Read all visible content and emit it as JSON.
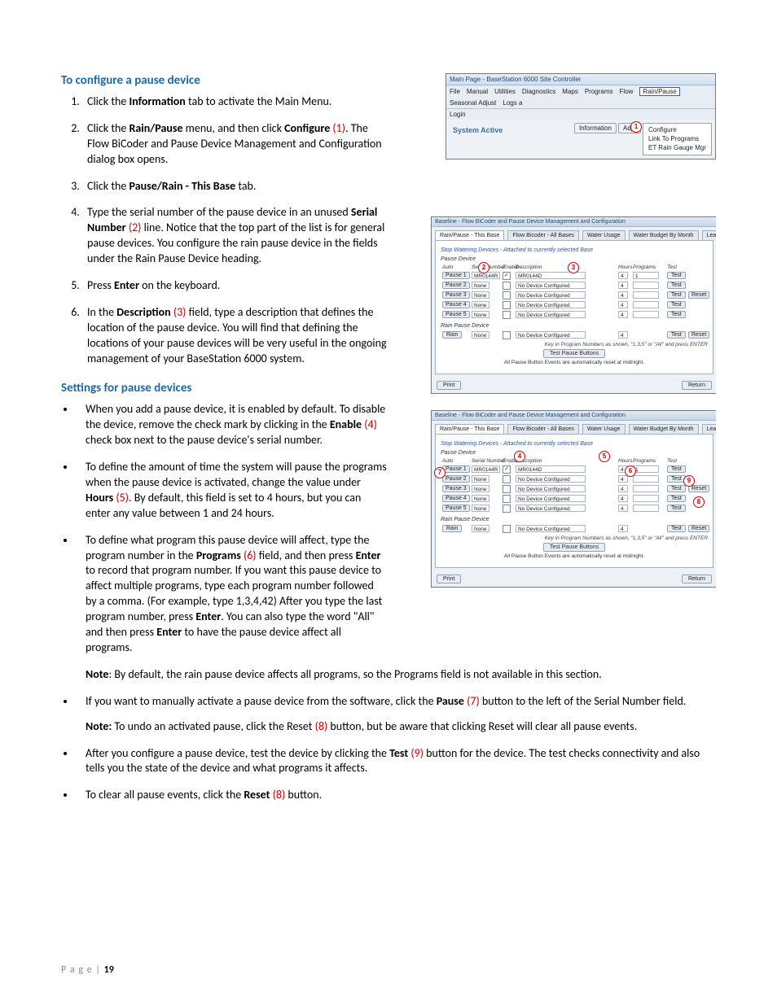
{
  "section1": {
    "heading": "To configure a pause device",
    "step1_a": "Click the ",
    "step1_b": "Information",
    "step1_c": " tab to activate the Main Menu.",
    "step2_a": "Click the ",
    "step2_b": "Rain/Pause",
    "step2_c": " menu, and then click ",
    "step2_d": "Configure",
    "step2_e": " (1)",
    "step2_f": ". The Flow BiCoder and Pause Device Management and Configuration dialog box opens.",
    "step3_a": "Click the ",
    "step3_b": "Pause/Rain - This Base",
    "step3_c": " tab.",
    "step4_a": "Type the serial number of the pause device in an unused ",
    "step4_b": "Serial Number",
    "step4_c": " (2)",
    "step4_d": " line. Notice that the top part of the list is for general pause devices. You configure the rain pause device in the fields under the Rain Pause Device heading.",
    "step5_a": "Press ",
    "step5_b": "Enter",
    "step5_c": " on the keyboard.",
    "step6_a": "In the ",
    "step6_b": "Description",
    "step6_c": " (3)",
    "step6_d": " field, type a description that defines the location of the pause device. You will find that defining the locations of your pause devices will be very useful in the ongoing management of your BaseStation 6000 system."
  },
  "section2": {
    "heading": "Settings for pause devices",
    "b1_a": "When you add a pause device, it is enabled by default. To disable the device, remove the check mark by clicking in the ",
    "b1_b": "Enable",
    "b1_c": " (4)",
    "b1_d": " check box next to the pause device's serial number.",
    "b2_a": "To define the amount of time the system will pause the programs when the pause device is activated, change the value under ",
    "b2_b": "Hours",
    "b2_c": " (5)",
    "b2_d": ". By default, this field is set to 4 hours, but you can enter any value between 1 and 24 hours.",
    "b3_a": "To define what program this pause device will affect, type the program number in the ",
    "b3_b": "Programs",
    "b3_c": " (6)",
    "b3_d": " field, and then press ",
    "b3_e": "Enter",
    "b3_f": " to record that program number. If you want this pause device to affect multiple programs, type each program number followed by a comma. (For example, type 1,3,4,42) After you type the last program number, press ",
    "b3_g": "Enter",
    "b3_h": ". You can also type the word \"All\" and then press ",
    "b3_i": "Enter",
    "b3_j": " to have the pause device affect all programs."
  },
  "full": {
    "note1_a": "Note",
    "note1_b": ": By default, the rain pause device affects all programs, so the Programs field is not available in this section.",
    "b4_a": "If you want to manually activate a pause device from the software, click the ",
    "b4_b": "Pause",
    "b4_c": " (7)",
    "b4_d": " button to the left of the Serial Number field.",
    "note2_a": "Note:",
    "note2_b": " To undo an activated pause, click the Reset ",
    "note2_c": "(8)",
    "note2_d": " button, but be aware that clicking Reset will clear all pause events.",
    "b5_a": "After you configure a pause device, test the device by clicking the ",
    "b5_b": "Test",
    "b5_c": " (9)",
    "b5_d": " button for the device. The test checks connectivity and also tells you the state of the device and what programs it affects.",
    "b6_a": "To clear all pause events, click the ",
    "b6_b": "Reset",
    "b6_c": " (8)",
    "b6_d": " button."
  },
  "footer": {
    "label": "P a g e   |",
    "num": "19"
  },
  "win_small": {
    "title": "Main Page - BaseStation 6000 Site Controller",
    "menus": [
      "File",
      "Manual",
      "Utilities",
      "Diagnostics",
      "Maps",
      "Programs",
      "Flow",
      "Rain/Pause",
      "Seasonal Adjust",
      "Logs a"
    ],
    "login": "Login",
    "sys": "System Active",
    "btn_info": "Information",
    "btn_adj": "Adju",
    "sub": [
      "Configure",
      "Link To Programs",
      "ET Rain Gauge Mgr"
    ],
    "c1": "1"
  },
  "dlg": {
    "title": "Baseline - Flow BiCoder and Pause Device Management and Configuration",
    "tabs": [
      "Rain/Pause - This Base",
      "Flow Bicoder - All Bases",
      "Water Usage",
      "Water Budget By Month",
      "Learn Flow"
    ],
    "group_title": "Stop Watering Devices - Attached to currently selected Base",
    "pause_device_title": "Pause Device",
    "rain_device_title": "Rain Pause Device",
    "cols_auto": "Auto",
    "cols_sn": "Serial Number",
    "cols_en": "Enable",
    "cols_desc": "Description",
    "cols_hours": "Hours",
    "cols_progs": "Programs",
    "cols_test": "Test",
    "rows": [
      {
        "name": "Pause 1",
        "sn": "MR0144R",
        "desc": "MR0144D",
        "hours": "4",
        "progs": "1",
        "en": "✓"
      },
      {
        "name": "Pause 2",
        "sn": "None",
        "desc": "No Device Configured",
        "hours": "4",
        "progs": "",
        "en": ""
      },
      {
        "name": "Pause 3",
        "sn": "None",
        "desc": "No Device Configured",
        "hours": "4",
        "progs": "",
        "en": ""
      },
      {
        "name": "Pause 4",
        "sn": "None",
        "desc": "No Device Configured",
        "hours": "4",
        "progs": "",
        "en": ""
      },
      {
        "name": "Pause 5",
        "sn": "None",
        "desc": "No Device Configured",
        "hours": "4",
        "progs": "",
        "en": ""
      }
    ],
    "rain": {
      "name": "Rain",
      "sn": "None",
      "desc": "No Device Configured",
      "hours": "4"
    },
    "test": "Test",
    "reset": "Reset",
    "test_pause_btn": "Test Pause Buttons",
    "hint": "Key in Program Numbers as shown, \"1,3,5\" or \"All\" and press ENTER",
    "footer_text": "All Pause Button Events are automatically reset at midnight.",
    "print": "Print",
    "return": "Return",
    "a2": "2",
    "a3": "3",
    "a4": "4",
    "a5": "5",
    "a6": "6",
    "a7": "7",
    "a8": "8",
    "a9": "9"
  }
}
